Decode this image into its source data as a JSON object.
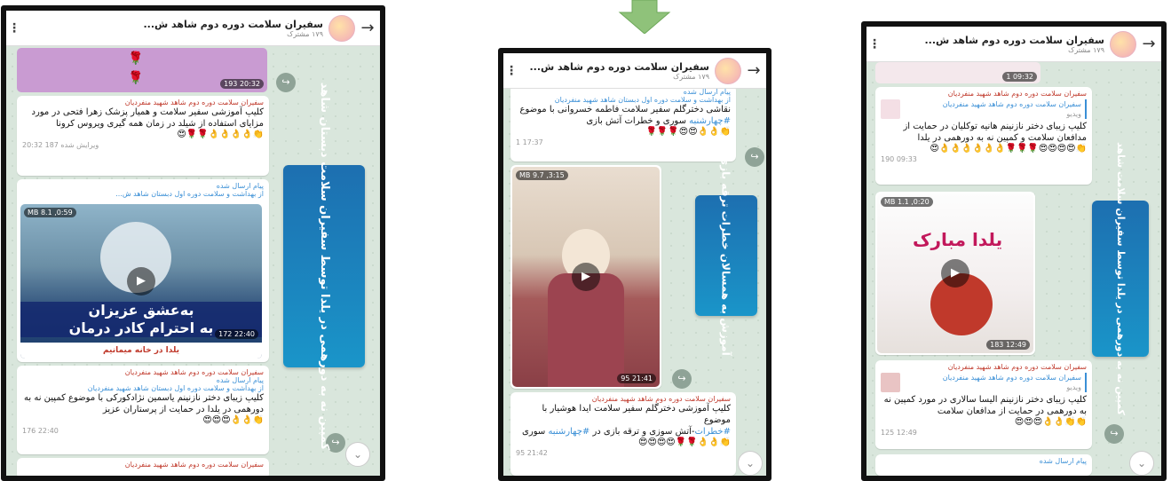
{
  "channel": {
    "title": "سفیران سلامت دوره دوم شاهد ش...",
    "subscribers": "۱۷۹ مشترک",
    "sender": "سفیران سلامت دوره دوم شاهد شهید منفردیان",
    "forwarded": "پیام ارسال شده",
    "forward_source": "از بهداشت و سلامت دوره اول دبستان  شاهد شهید منفردیان",
    "video_label": "ویدیو"
  },
  "left": {
    "top_video_meta": "193  20:32",
    "m1_text": "کلیپ آموزشی سفیر سلامت و همیار پزشک  زهرا فتحی در مورد مزایای استفاده از شیلد در زمان همه گیری ویروس کرونا",
    "m1_emoji": "👏👌👌👌👌🌹🌹😍",
    "m1_meta": "ویرایش شده  187  20:32",
    "m2_forward_src": "از بهداشت و سلامت دوره اول دبستان  شاهد ش...",
    "m2_video_badge": "0:59, 8.1 MB",
    "m2_video_caption1": "به‌عشق عزیزان",
    "m2_video_caption2": "به احترام کادر درمان",
    "m2_video_caption3": "یلدا در خانه میمانیم",
    "m2_video_meta": "172  22:40",
    "m3_text": "کلیپ زیبای دختر نازنینم یاسمین نژادکورکی با موضوع کمپین نه به دورهمی در یلدا در حمایت از پرستاران عزیز",
    "m3_emoji": "👏👌👌😍😍😍",
    "m3_meta": "176  22:40",
    "banner": "کمپین نه به دورهمی در یلدا توسط سفیران سلامت دبستان شاهد"
  },
  "middle": {
    "m1_text": "نقاشی دخترگلم سفیر سلامت فاطمه خسروانی با موضوع",
    "m1_hashtag": "#چهارشنبه",
    "m1_text2": "سوری و خطرات آتش بازی",
    "m1_emoji": "👏👌👌😍😍🌹🌹🌹",
    "m1_meta": "1  17:37",
    "video_badge": "3:15, 9.7 MB",
    "video_meta": "95  21:41",
    "m2_text": "کلیپ آموزشی دخترگلم سفیر سلامت ایدا هوشیار با موضوع",
    "m2_hashtag": "#خطرات",
    "m2_text2": "آتش سوزی و ترقه بازی در",
    "m2_hashtag2": "#چهارشنبه",
    "m2_text3": "سوری",
    "m2_emoji": "👏👌👌🌹🌹😍😍😍😍",
    "m2_meta": "95  21:42",
    "banner": "آموزش به همسالان خطرات ترقه بازی"
  },
  "right": {
    "top_meta": "1  09:32",
    "m1_text": "کلیپ زیبای دختر نازنینم هانیه توکلیان در حمایت از مدافعان سلامت  و کمپین نه به دورهمی در یلدا",
    "m1_emoji": "👏😍😍😍😍🌹🌹🌹👌👌👌👌👌👌😍",
    "m1_meta": "190  09:33",
    "video_badge": "0:20, 1.1 MB",
    "video_text": "یلدا مبارک",
    "video_meta": "183  12:49",
    "m2_text": "کلیپ زیبای دختر نازنینم الیسا سالاری در مورد کمپین نه به دورهمی در حمایت از مدافعان سلامت",
    "m2_emoji": "👏👏👌👌😍😍😍",
    "m2_meta": "125  12:49",
    "m3_forward": "پیام ارسال شده",
    "banner": "کمپین نه به دورهمی در یلدا توسط سفیران سلامت شاهد"
  }
}
